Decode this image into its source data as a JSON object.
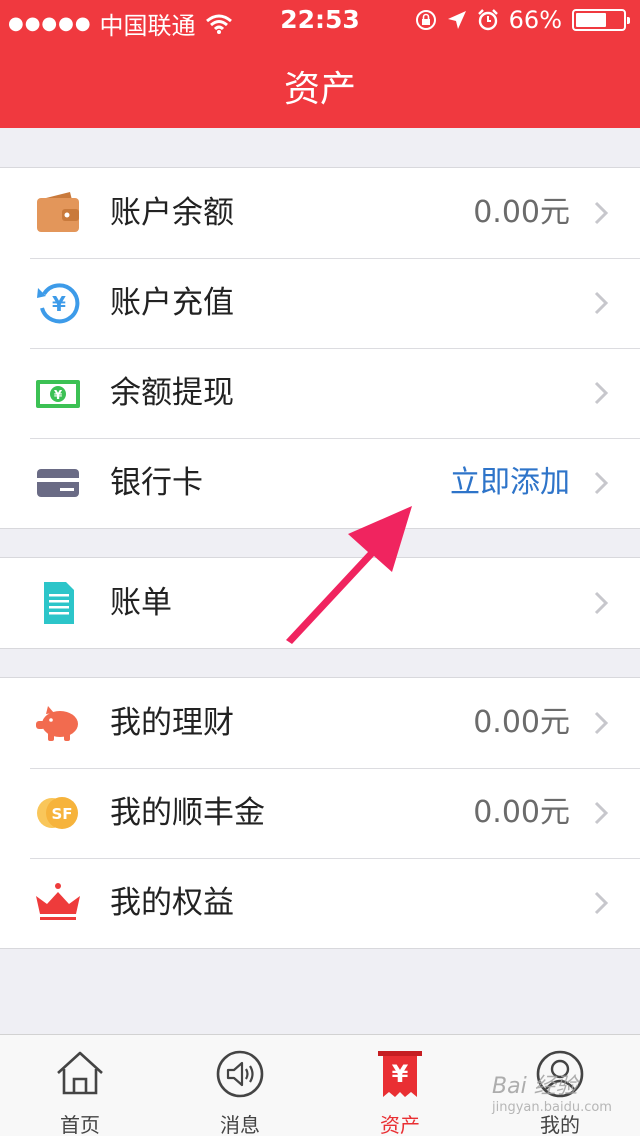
{
  "status_bar": {
    "signal_dots": "●●●●●",
    "carrier": "中国联通",
    "time": "22:53",
    "battery": "66%",
    "battery_level": 0.66
  },
  "header": {
    "title": "资产"
  },
  "groups": [
    {
      "items": [
        {
          "icon": "wallet-icon",
          "label": "账户余额",
          "value": "0.00元",
          "color": "#e3965a"
        },
        {
          "icon": "recharge-icon",
          "label": "账户充值",
          "value": "",
          "color": "#3d9be9"
        },
        {
          "icon": "cash-icon",
          "label": "余额提现",
          "value": "",
          "color": "#3cc154"
        },
        {
          "icon": "bank-card-icon",
          "label": "银行卡",
          "value": "立即添加",
          "color": "#6a6b85"
        }
      ]
    },
    {
      "items": [
        {
          "icon": "bill-icon",
          "label": "账单",
          "value": "",
          "color": "#2cc5c9"
        }
      ]
    },
    {
      "items": [
        {
          "icon": "piggy-bank-icon",
          "label": "我的理财",
          "value": "0.00元",
          "color": "#f26b4f"
        },
        {
          "icon": "sf-coin-icon",
          "label": "我的顺丰金",
          "value": "0.00元",
          "color": "#f6b33c"
        },
        {
          "icon": "crown-icon",
          "label": "我的权益",
          "value": "",
          "color": "#ee3b3b"
        }
      ]
    }
  ],
  "tabbar": [
    {
      "icon": "home-icon",
      "label": "首页",
      "active": false
    },
    {
      "icon": "message-icon",
      "label": "消息",
      "active": false
    },
    {
      "icon": "assets-icon",
      "label": "资产",
      "active": true
    },
    {
      "icon": "profile-icon",
      "label": "我的",
      "active": false
    }
  ],
  "watermark": {
    "text": "Bai 经验",
    "sub": "jingyan.baidu.com"
  },
  "colors": {
    "header": "#f0393f",
    "accent_blue": "#2e74c9",
    "arrow": "#f0245f"
  }
}
